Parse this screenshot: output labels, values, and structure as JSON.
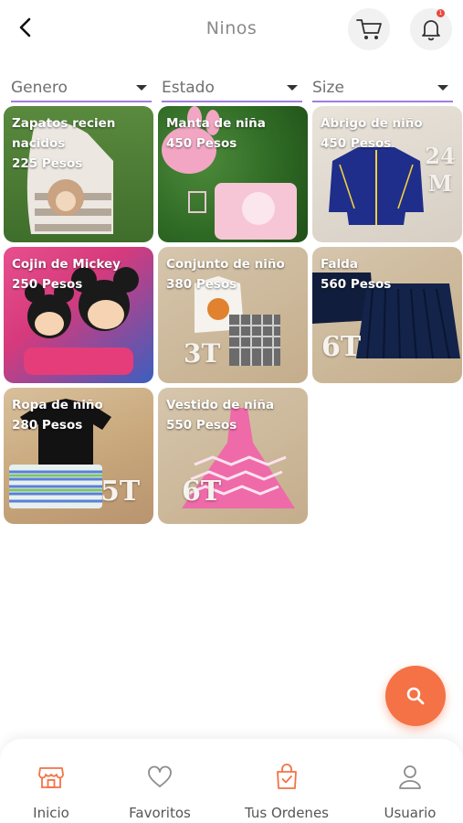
{
  "header": {
    "title": "Ninos",
    "notification_count": "1"
  },
  "filters": [
    {
      "label": "Genero"
    },
    {
      "label": "Estado"
    },
    {
      "label": "Size"
    }
  ],
  "products": [
    {
      "name": "Zapatos recien nacidos",
      "price": "225 Pesos"
    },
    {
      "name": "Manta de niña",
      "price": "450 Pesos"
    },
    {
      "name": "Abrigo de niño",
      "price": "450 Pesos"
    },
    {
      "name": "Cojin de Mickey",
      "price": "250 Pesos"
    },
    {
      "name": "Conjunto de niño",
      "price": "380 Pesos"
    },
    {
      "name": "Falda",
      "price": "560 Pesos"
    },
    {
      "name": "Ropa de niño",
      "price": "280 Pesos"
    },
    {
      "name": "Vestido de niña",
      "price": "550 Pesos"
    }
  ],
  "image_labels": {
    "coat_size": "24 M",
    "set_size": "3T",
    "skirt_size": "6T",
    "clothes_size": "5T",
    "dress_size": "6T"
  },
  "nav": [
    {
      "label": "Inicio",
      "icon": "store-icon"
    },
    {
      "label": "Favoritos",
      "icon": "heart-icon"
    },
    {
      "label": "Tus Ordenes",
      "icon": "orders-bag-icon"
    },
    {
      "label": "Usuario",
      "icon": "user-icon"
    }
  ],
  "colors": {
    "accent": "#f47245",
    "filter_underline": "#9e7fe0"
  }
}
